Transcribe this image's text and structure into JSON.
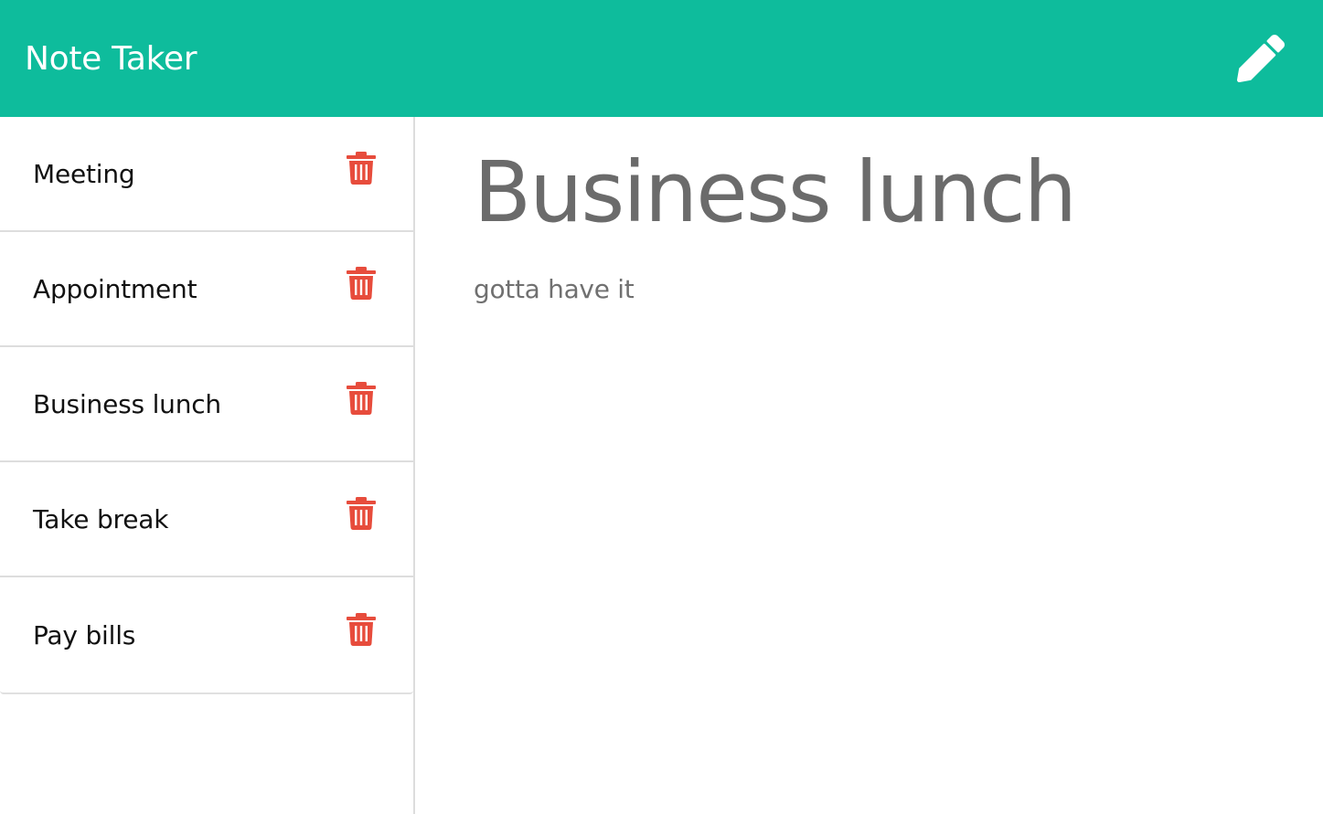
{
  "app": {
    "title": "Note Taker",
    "accent_color": "#0ebc9c",
    "delete_color": "#e74c3c"
  },
  "navbar": {
    "new_note_icon": "pencil-icon"
  },
  "sidebar": {
    "notes": [
      {
        "title": "Meeting",
        "icon": "trash-icon"
      },
      {
        "title": "Appointment",
        "icon": "trash-icon"
      },
      {
        "title": "Business lunch",
        "icon": "trash-icon"
      },
      {
        "title": "Take break",
        "icon": "trash-icon"
      },
      {
        "title": "Pay bills",
        "icon": "trash-icon"
      }
    ]
  },
  "editor": {
    "title_value": "Business lunch",
    "text_value": "gotta have it"
  }
}
